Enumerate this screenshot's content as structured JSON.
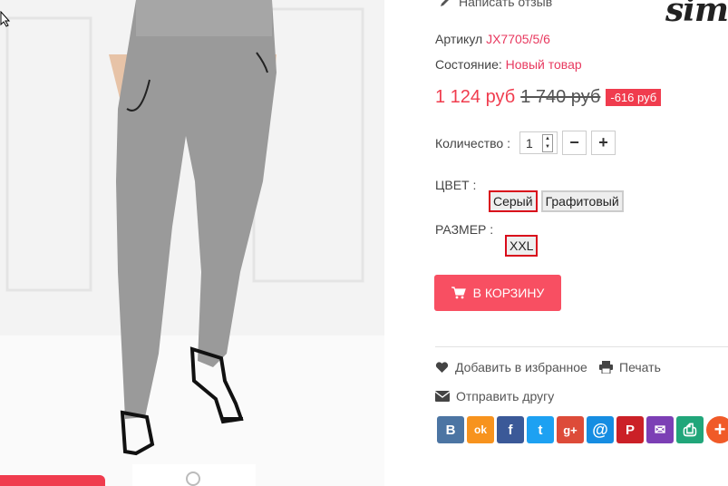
{
  "header": {
    "write_review": "Написать отзыв",
    "logo_text": "sim"
  },
  "product": {
    "sku_label": "Артикул",
    "sku_value": "JX7705/5/6",
    "condition_label": "Состояние:",
    "condition_value": "Новый товар",
    "price": "1 124 руб",
    "old_price": "1 740 руб",
    "discount": "-616 руб"
  },
  "quantity": {
    "label": "Количество :",
    "value": "1",
    "minus": "−",
    "plus": "+"
  },
  "attributes": {
    "color_label": "ЦВЕТ :",
    "colors": [
      {
        "label": "Серый",
        "selected": true
      },
      {
        "label": "Графитовый",
        "selected": false
      }
    ],
    "size_label": "РАЗМЕР :",
    "sizes": [
      {
        "label": "XXL",
        "selected": true
      }
    ]
  },
  "cart": {
    "label": "В КОРЗИНУ"
  },
  "actions": {
    "favorite": "Добавить в избранное",
    "print": "Печать",
    "send": "Отправить другу"
  },
  "share": [
    {
      "name": "vk-icon",
      "glyph": "B",
      "color": "#4c75a3"
    },
    {
      "name": "odnoklassniki-icon",
      "glyph": "ok",
      "color": "#f7931e"
    },
    {
      "name": "facebook-icon",
      "glyph": "f",
      "color": "#3b5998"
    },
    {
      "name": "twitter-icon",
      "glyph": "t",
      "color": "#1da1f2"
    },
    {
      "name": "google-plus-icon",
      "glyph": "g+",
      "color": "#dd4b39"
    },
    {
      "name": "mail-ru-icon",
      "glyph": "@",
      "color": "#168de2"
    },
    {
      "name": "pinterest-icon",
      "glyph": "P",
      "color": "#cb2027"
    },
    {
      "name": "email-icon",
      "glyph": "✉",
      "color": "#7c3fb5"
    },
    {
      "name": "print-share-icon",
      "glyph": "⎙",
      "color": "#21a67a"
    },
    {
      "name": "more-icon",
      "glyph": "+",
      "color": "#f05a28"
    }
  ],
  "colors": {
    "accent": "#f03c4e",
    "cart_button": "#f84f62",
    "selected_border": "#d90b1b"
  }
}
